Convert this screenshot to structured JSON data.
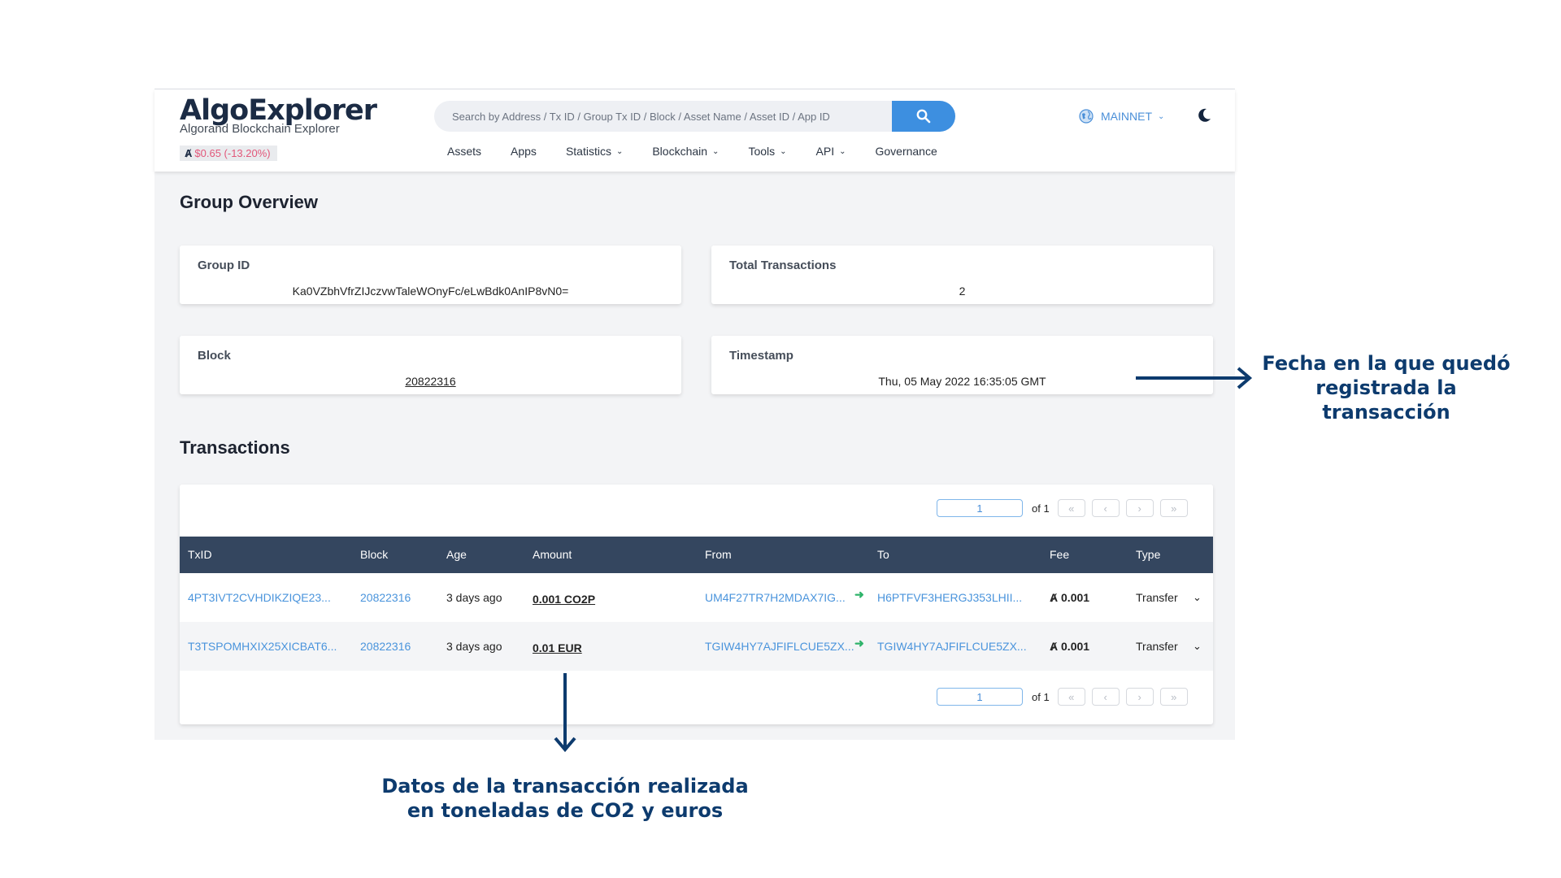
{
  "brand": {
    "name_part1": "Algo",
    "name_part2": "Explorer",
    "tagline": "Algorand Blockchain Explorer",
    "price": "$0.65 (-13.20%)",
    "price_symbol": "Ⱥ"
  },
  "search": {
    "placeholder": "Search by Address / Tx ID / Group Tx ID / Block / Asset Name / Asset ID / App ID"
  },
  "nav": {
    "items": [
      "Assets",
      "Apps",
      "Statistics",
      "Blockchain",
      "Tools",
      "API",
      "Governance"
    ]
  },
  "network": {
    "label": "MAINNET"
  },
  "group_overview": {
    "title": "Group Overview",
    "group_id_label": "Group ID",
    "group_id": "Ka0VZbhVfrZIJczvwTaleWOnyFc/eLwBdk0AnIP8vN0=",
    "total_label": "Total Transactions",
    "total": "2",
    "block_label": "Block",
    "block": "20822316",
    "timestamp_label": "Timestamp",
    "timestamp": "Thu, 05 May 2022 16:35:05 GMT"
  },
  "transactions": {
    "title": "Transactions",
    "pager": {
      "page": "1",
      "of": "of 1",
      "first": "«",
      "prev": "‹",
      "next": "›",
      "last": "»"
    },
    "columns": [
      "TxID",
      "Block",
      "Age",
      "Amount",
      "From",
      "To",
      "Fee",
      "Type"
    ],
    "rows": [
      {
        "txid": "4PT3IVT2CVHDIKZIQE23...",
        "block": "20822316",
        "age": "3 days ago",
        "amount": "0.001 CO2P",
        "from": "UM4F27TR7H2MDAX7IG...",
        "to": "H6PTFVF3HERGJ353LHII...",
        "fee": "0.001",
        "type": "Transfer"
      },
      {
        "txid": "T3TSPOMHXIX25XICBAT6...",
        "block": "20822316",
        "age": "3 days ago",
        "amount": "0.01 EUR",
        "from": "TGIW4HY7AJFIFLCUE5ZX...",
        "to": "TGIW4HY7AJFIFLCUE5ZX...",
        "fee": "0.001",
        "type": "Transfer"
      }
    ]
  },
  "annotations": {
    "timestamp_note_line1": "Fecha en la que quedó",
    "timestamp_note_line2": "registrada la transacción",
    "amount_note_line1": "Datos de la transacción realizada",
    "amount_note_line2": "en toneladas de CO2 y euros"
  },
  "colors": {
    "header_row": "#34465f",
    "link": "#4a94dc",
    "accent": "#3d8fe0",
    "annotation": "#0d3b6e",
    "price_down": "#e2577a"
  }
}
